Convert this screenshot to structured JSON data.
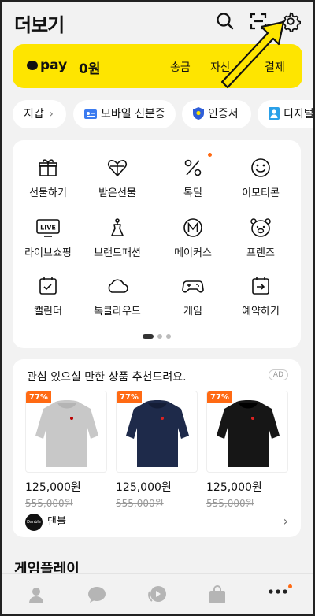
{
  "header": {
    "title": "더보기",
    "icons": [
      "search-icon",
      "scan-icon",
      "gear-icon"
    ]
  },
  "pay": {
    "brand": "pay",
    "balance": "0원",
    "actions": [
      "송금",
      "자산",
      "결제"
    ]
  },
  "chips": [
    {
      "label": "지갑",
      "icon": "chevron-right-icon"
    },
    {
      "label": "모바일 신분증",
      "icon": "id-card-icon"
    },
    {
      "label": "인증서",
      "icon": "shield-icon"
    },
    {
      "label": "디지털",
      "icon": "person-card-icon"
    }
  ],
  "grid": {
    "items": [
      {
        "label": "선물하기",
        "icon": "gift-box-icon"
      },
      {
        "label": "받은선물",
        "icon": "gift-heart-icon"
      },
      {
        "label": "톡딜",
        "icon": "percent-icon"
      },
      {
        "label": "이모티콘",
        "icon": "smile-icon"
      },
      {
        "label": "라이브쇼핑",
        "icon": "live-tv-icon"
      },
      {
        "label": "브랜드패션",
        "icon": "hanger-icon"
      },
      {
        "label": "메이커스",
        "icon": "makers-icon"
      },
      {
        "label": "프렌즈",
        "icon": "friend-face-icon"
      },
      {
        "label": "캘린더",
        "icon": "calendar-icon"
      },
      {
        "label": "톡클라우드",
        "icon": "cloud-icon"
      },
      {
        "label": "게임",
        "icon": "gamepad-icon"
      },
      {
        "label": "예약하기",
        "icon": "reservation-icon"
      }
    ],
    "page_indicator": {
      "current": 1,
      "total": 3
    }
  },
  "recommend": {
    "title": "관심 있으실 만한 상품 추천드려요.",
    "ad_label": "AD",
    "products": [
      {
        "badge": "77%",
        "price": "125,000원",
        "original": "555,000원",
        "color": "#c8c8c8"
      },
      {
        "badge": "77%",
        "price": "125,000원",
        "original": "555,000원",
        "color": "#1e2a4a"
      },
      {
        "badge": "77%",
        "price": "125,000원",
        "original": "555,000원",
        "color": "#161616"
      }
    ],
    "brand": {
      "name": "댄블",
      "logo_text": "Danble"
    }
  },
  "section2": {
    "title": "게임플레이"
  },
  "nav": {
    "items": [
      "person-icon",
      "chat-icon",
      "openchat-icon",
      "shopping-bag-icon",
      "more-icon"
    ]
  },
  "colors": {
    "accent": "#fee500",
    "badge": "#ff6a13",
    "notice_dot": "#ff6a13"
  }
}
